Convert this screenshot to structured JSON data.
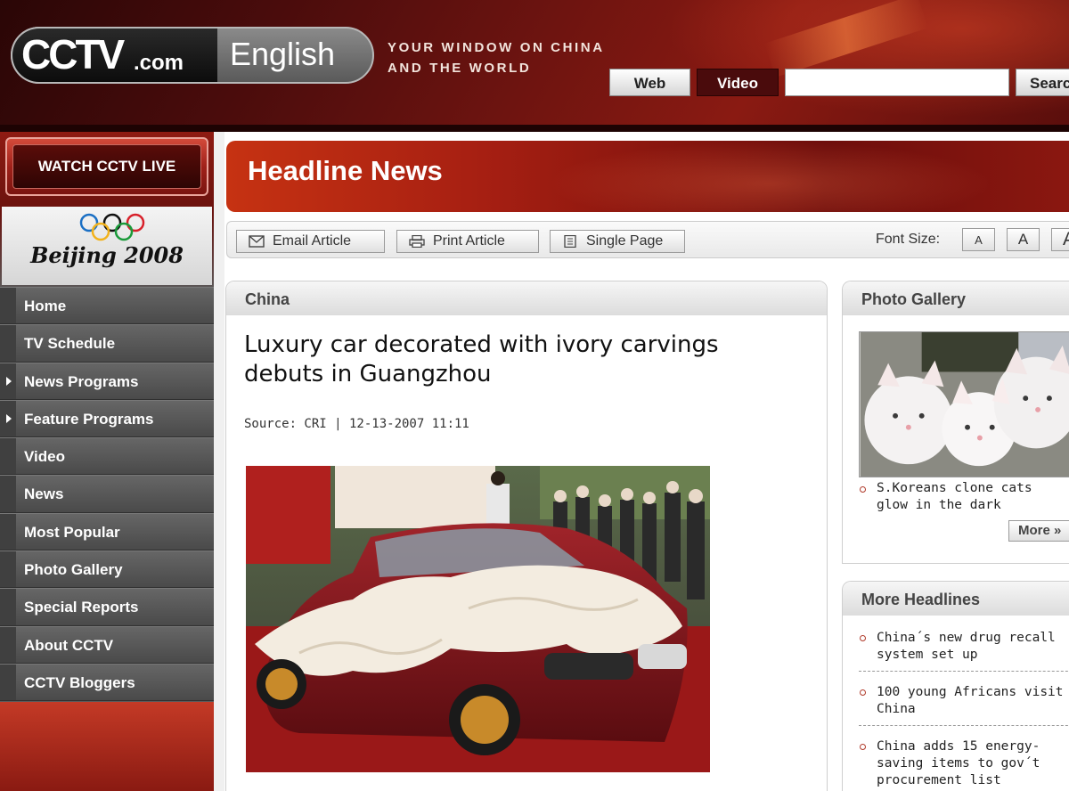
{
  "header": {
    "logo_text": "CCTV",
    "logo_suffix": ".com",
    "edition": "English",
    "tagline_line1": "YOUR WINDOW ON CHINA",
    "tagline_line2": "AND THE WORLD",
    "search_tabs": [
      "Web",
      "Video"
    ],
    "search_value": "",
    "search_button": "Search"
  },
  "sidebar": {
    "live_button": "WATCH CCTV LIVE",
    "olympics_text": "Beijing 2008",
    "nav": [
      {
        "label": "Home",
        "arrow": false
      },
      {
        "label": "TV Schedule",
        "arrow": false
      },
      {
        "label": "News Programs",
        "arrow": true
      },
      {
        "label": "Feature Programs",
        "arrow": true
      },
      {
        "label": "Video",
        "arrow": false
      },
      {
        "label": "News",
        "arrow": false
      },
      {
        "label": "Most Popular",
        "arrow": false
      },
      {
        "label": "Photo Gallery",
        "arrow": false
      },
      {
        "label": "Special Reports",
        "arrow": false
      },
      {
        "label": "About CCTV",
        "arrow": false
      },
      {
        "label": "CCTV Bloggers",
        "arrow": false
      }
    ]
  },
  "main": {
    "section_title": "Headline News",
    "toolbar": {
      "email": "Email Article",
      "print": "Print Article",
      "single": "Single Page",
      "font_size_label": "Font Size:",
      "font_sizes": [
        "A",
        "A",
        "A"
      ]
    },
    "article": {
      "category": "China",
      "title": "Luxury car decorated with ivory carvings debuts in Guangzhou",
      "source": "Source: CRI | 12-13-2007 11:11"
    }
  },
  "right": {
    "gallery": {
      "title": "Photo Gallery",
      "caption": "S.Koreans clone cats glow in the dark",
      "more": "More »"
    },
    "headlines": {
      "title": "More Headlines",
      "items": [
        "China´s new drug recall system set up",
        "100 young Africans visit China",
        "China adds 15 energy-saving items to gov´t procurement list"
      ]
    }
  },
  "colors": {
    "brand_red": "#a61f12",
    "header_dark": "#2a0606",
    "nav_gray": "#555555",
    "bullet": "#b03a2a"
  }
}
